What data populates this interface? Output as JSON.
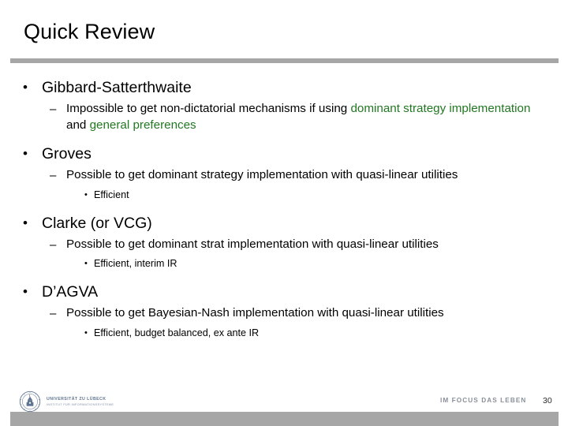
{
  "slide": {
    "title": "Quick Review",
    "accent_rule_color": "#a6a6a6",
    "highlight_color": "#217821",
    "background_color": "#ffffff"
  },
  "content": {
    "groups": [
      {
        "heading": "Gibbard-Satterthwaite",
        "sub": {
          "pre": "Impossible to get non-dictatorial mechanisms if using ",
          "hl1": "dominant strategy implementation",
          "mid": " and ",
          "hl2": "general preferences"
        },
        "subsub": null
      },
      {
        "heading": "Groves",
        "sub": {
          "pre": "Possible to get dominant strategy implementation with quasi-linear utilities",
          "hl1": "",
          "mid": "",
          "hl2": ""
        },
        "subsub": "Efficient"
      },
      {
        "heading": "Clarke (or VCG)",
        "sub": {
          "pre": "Possible to get dominant strat implementation with quasi-linear utilities",
          "hl1": "",
          "mid": "",
          "hl2": ""
        },
        "subsub": "Efficient, interim IR"
      },
      {
        "heading": "D’AGVA",
        "sub": {
          "pre": "Possible to get Bayesian-Nash implementation with quasi-linear utilities",
          "hl1": "",
          "mid": "",
          "hl2": ""
        },
        "subsub": "Efficient, budget balanced, ex ante IR"
      }
    ],
    "markers": {
      "level1": "•",
      "level2": "–",
      "level3": "•"
    }
  },
  "footer": {
    "logo_line1": "UNIVERSITÄT ZU LÜBECK",
    "logo_line2": "INSTITUT FÜR INFORMATIONSSYSTEME",
    "slogan": "IM FOCUS DAS LEBEN",
    "page_number": "30"
  }
}
